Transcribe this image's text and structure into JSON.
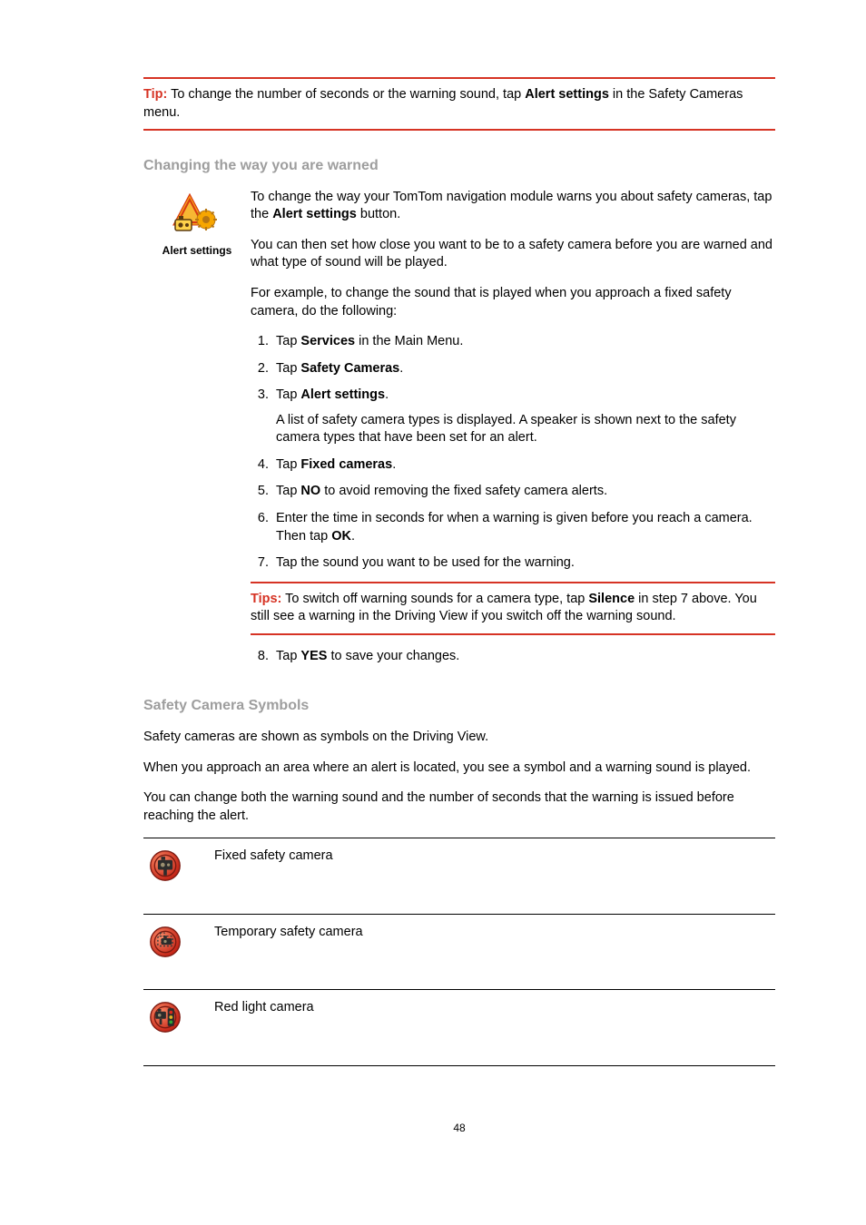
{
  "tipTop": {
    "label": "Tip:",
    "text_before": "To change the number of seconds or the warning sound, tap ",
    "bold": "Alert settings",
    "text_after": " in the Safety Cameras menu."
  },
  "section1": {
    "heading": "Changing the way you are warned",
    "iconCaption": "Alert settings",
    "p1_before": "To change the way your TomTom navigation module warns you about safety cameras, tap the ",
    "p1_bold": "Alert settings",
    "p1_after": " button.",
    "p2": "You can then set how close you want to be to a safety camera before you are warned and what type of sound will be played.",
    "p3": "For example, to change the sound that is played when you approach a fixed safety camera, do the following:",
    "steps": [
      {
        "num": "1.",
        "pre": "Tap ",
        "bold": "Services",
        "post": " in the Main Menu."
      },
      {
        "num": "2.",
        "pre": "Tap ",
        "bold": "Safety Cameras",
        "post": "."
      },
      {
        "num": "3.",
        "pre": "Tap ",
        "bold": "Alert settings",
        "post": "."
      }
    ],
    "sub3": "A list of safety camera types is displayed. A speaker is shown next to the safety camera types that have been set for an alert.",
    "steps2": [
      {
        "num": "4.",
        "pre": "Tap ",
        "bold": "Fixed cameras",
        "post": "."
      },
      {
        "num": "5.",
        "pre": "Tap ",
        "bold": "NO",
        "post": " to avoid removing the fixed safety camera alerts."
      },
      {
        "num": "6.",
        "pre": "Enter the time in seconds for when a warning is given before you reach a camera. Then tap ",
        "bold": "OK",
        "post": "."
      },
      {
        "num": "7.",
        "pre": "Tap the sound you want to be used for the warning.",
        "bold": "",
        "post": ""
      }
    ],
    "innerTip": {
      "label": "Tips:",
      "pre": " To switch off warning sounds for a camera type, tap ",
      "bold": "Silence",
      "post": " in step 7 above. You still see a warning in the Driving View if you switch off the warning sound."
    },
    "step8": {
      "num": "8.",
      "pre": "Tap ",
      "bold": "YES",
      "post": " to save your changes."
    }
  },
  "section2": {
    "heading": "Safety Camera Symbols",
    "p1": "Safety cameras are shown as symbols on the Driving View.",
    "p2": "When you approach an area where an alert is located, you see a symbol and a warning sound is played.",
    "p3": "You can change both the warning sound and the number of seconds that the warning is issued before reaching the alert.",
    "rows": [
      {
        "label": "Fixed safety camera"
      },
      {
        "label": "Temporary safety camera"
      },
      {
        "label": "Red light camera"
      }
    ]
  },
  "pageNumber": "48"
}
